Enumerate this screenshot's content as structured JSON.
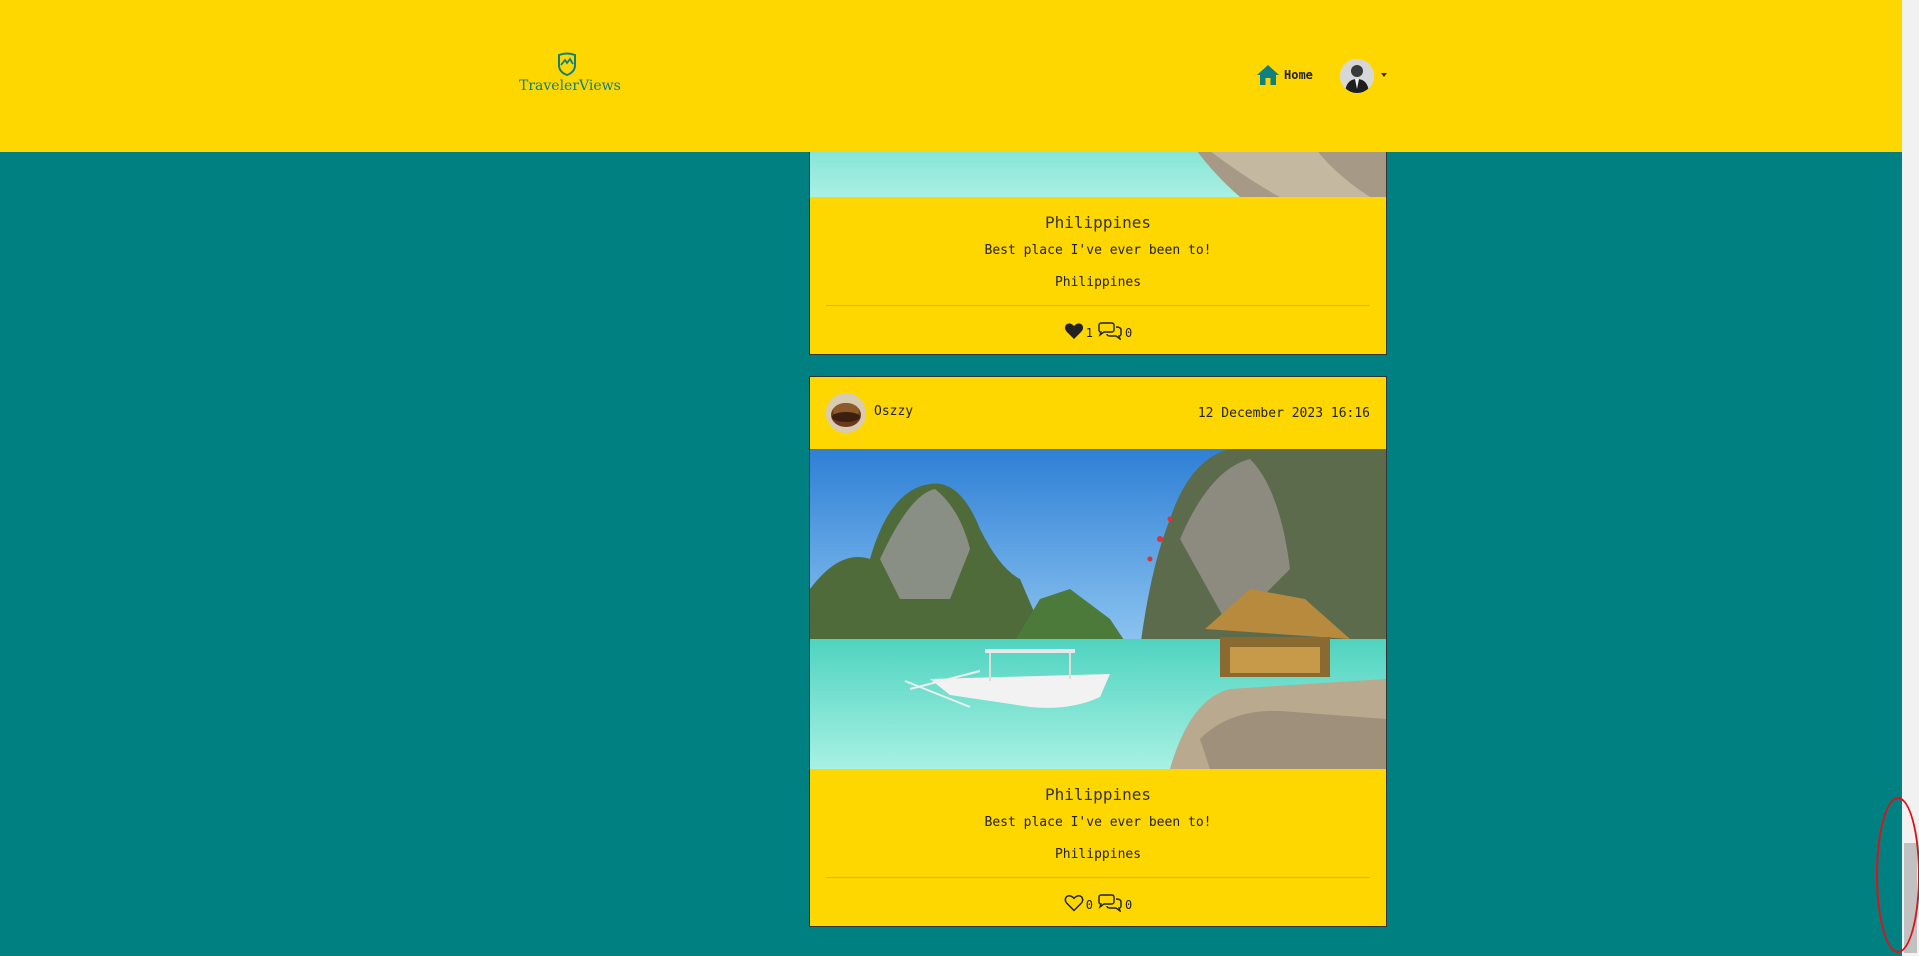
{
  "navbar": {
    "brand": "TravelerViews",
    "home_label": "Home",
    "icons": {
      "brand": "mountain-shield-icon",
      "home": "home-icon",
      "avatar": "user-avatar",
      "caret": "caret-down-icon"
    }
  },
  "posts": [
    {
      "title": "Philippines",
      "description": "Best place I've ever been to!",
      "country": "Philippines",
      "likes": "1",
      "comments": "0",
      "liked": true
    },
    {
      "username": "Oszzy",
      "date": "12 December 2023 16:16",
      "title": "Philippines",
      "description": "Best place I've ever been to!",
      "country": "Philippines",
      "likes": "0",
      "comments": "0",
      "liked": false
    }
  ],
  "colors": {
    "navbar": "#FFD700",
    "background": "#008080",
    "card": "#FFD700",
    "brand": "#0f7f80",
    "annotation": "#e0101a"
  }
}
